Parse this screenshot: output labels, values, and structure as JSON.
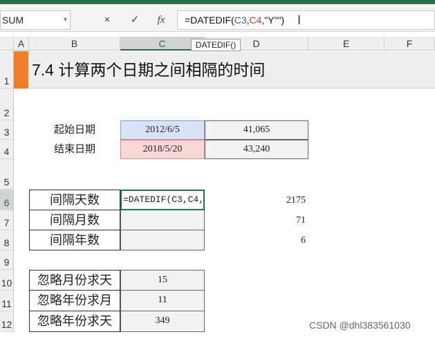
{
  "name_box": {
    "value": "SUM"
  },
  "formula_bar": {
    "cancel_icon": "×",
    "enter_icon": "✓",
    "fx_label": "fx",
    "formula_prefix": "=DATEDIF(",
    "ref1": "C3",
    "sep1": ",",
    "ref2": "C4",
    "formula_suffix": ",\"Y\"\")"
  },
  "tooltip": "DATEDIF()",
  "columns": [
    "A",
    "B",
    "C",
    "D",
    "E",
    "F"
  ],
  "rows": [
    "1",
    "2",
    "3",
    "4",
    "5",
    "6",
    "7",
    "8",
    "9",
    "10",
    "11",
    "12"
  ],
  "title": "7.4 计算两个日期之间相隔的时间",
  "dates": [
    {
      "label": "起始日期",
      "date": "2012/6/5",
      "serial": "41,065"
    },
    {
      "label": "结束日期",
      "date": "2018/5/20",
      "serial": "43,240"
    }
  ],
  "intervals": [
    {
      "label": "间隔天数",
      "cell": "=DATEDIF(C3,C4,",
      "result": "2175"
    },
    {
      "label": "间隔月数",
      "cell": "",
      "result": "71"
    },
    {
      "label": "间隔年数",
      "cell": "",
      "result": "6"
    }
  ],
  "ignore": [
    {
      "label": "忽略月份求天",
      "value": "15"
    },
    {
      "label": "忽略年份求月",
      "value": "11"
    },
    {
      "label": "忽略年份求天",
      "value": "349"
    }
  ],
  "watermark": "CSDN @dhl383561030",
  "colors": {
    "excel_green": "#217346",
    "accent_orange": "#f07e26"
  }
}
